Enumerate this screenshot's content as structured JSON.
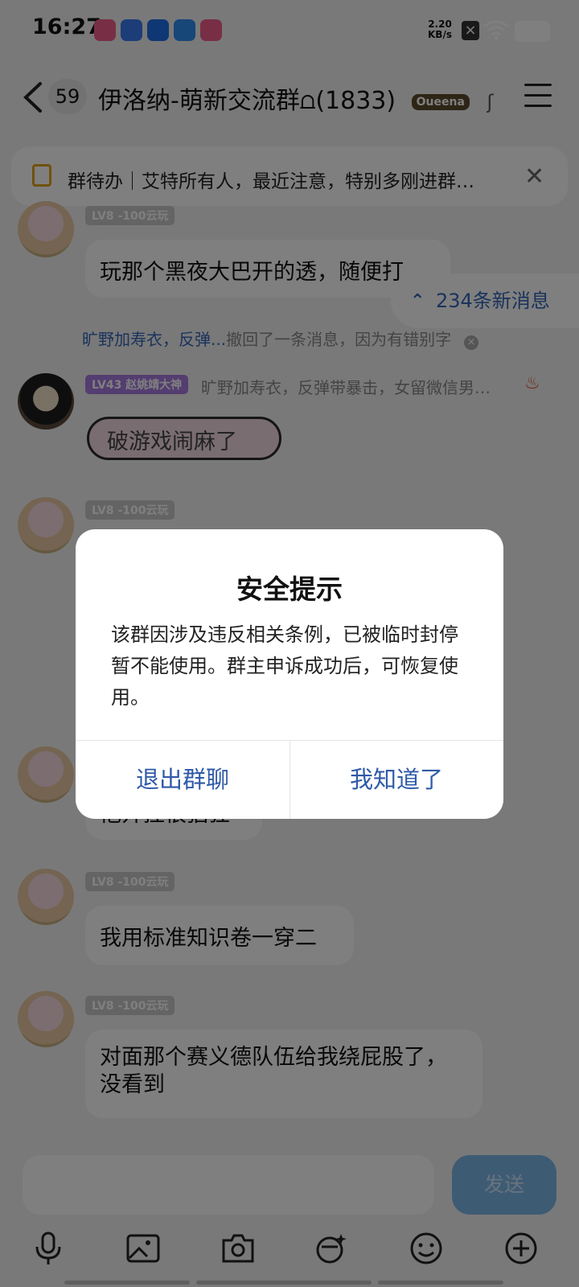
{
  "status": {
    "time": "16:27",
    "net_speed_top": "2.20",
    "net_speed_unit": "KB/s",
    "app_icon_colors": [
      "#f05e8c",
      "#3b7bf2",
      "#1f6fe6",
      "#2f8cf0",
      "#f05e8c"
    ]
  },
  "header": {
    "unread_badge": "59",
    "group_title": "伊洛纳-萌新交流群⩍(1833)",
    "title_logo": "Oueena"
  },
  "todo": {
    "text": "群待办｜艾特所有人，最近注意，特别多刚进群…"
  },
  "messages": [
    {
      "level": "LV8 -100云玩",
      "text": "玩那个黑夜大巴开的透，随便打"
    },
    {
      "level": "LV43 赵姚靖大神",
      "quote": "旷野加寿衣，反弹带暴击，女留微信男…",
      "sticker": "破游戏闹麻了"
    },
    {
      "level": "LV8 -100云玩"
    },
    {
      "level": "LV8 -100云玩",
      "text": "他开挂很猖狂"
    },
    {
      "level": "LV8 -100云玩",
      "text": "我用标准知识卷一穿二"
    },
    {
      "level": "LV8 -100云玩",
      "text": "对面那个赛义德队伍给我绕屁股了，没看到"
    }
  ],
  "system_notice": {
    "name": "旷野加寿衣，反弹...",
    "text": "撤回了一条消息，因为有错别字"
  },
  "new_messages": "234条新消息",
  "dialog": {
    "title": "安全提示",
    "message": "该群因涉及违反相关条例，已被临时封停暂不能使用。群主申诉成功后，可恢复使用。",
    "left_button": "退出群聊",
    "right_button": "我知道了"
  },
  "composer": {
    "send_label": "发送"
  },
  "toolbar_icons": [
    "mic-icon",
    "image-icon",
    "camera-icon",
    "sticker-icon",
    "emoji-icon",
    "plus-icon"
  ]
}
